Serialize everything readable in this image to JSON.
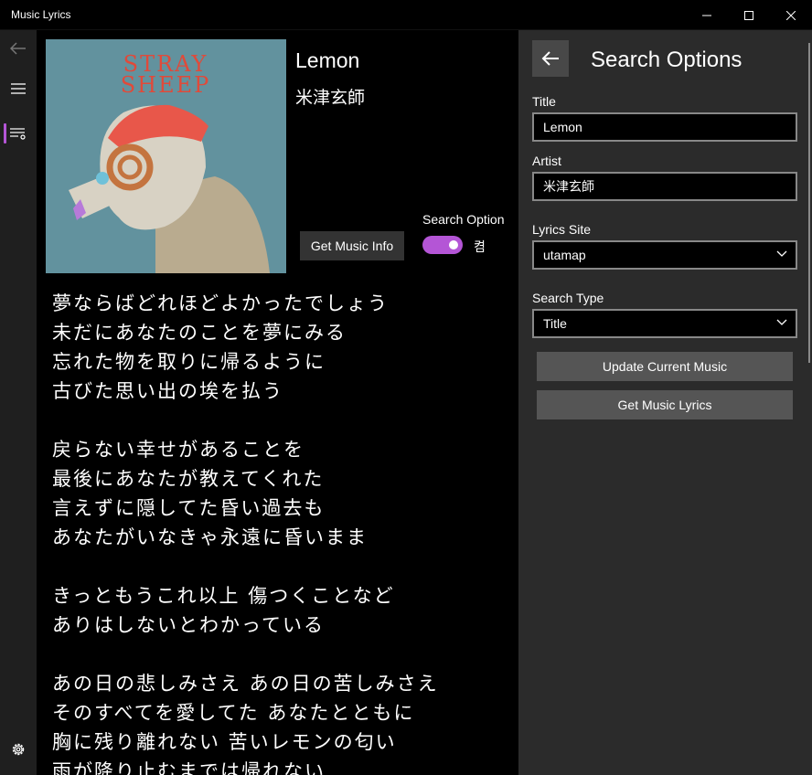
{
  "window": {
    "title": "Music Lyrics"
  },
  "nav": {
    "back_icon": "back-arrow-icon",
    "menu_icon": "hamburger-icon",
    "lyrics_icon": "lyrics-list-icon",
    "settings_icon": "gear-icon",
    "accent": "#b455d6"
  },
  "song": {
    "title": "Lemon",
    "artist": "米津玄師",
    "album_art_text": "STRAY SHEEP"
  },
  "controls": {
    "get_info_label": "Get Music Info",
    "search_option_label": "Search Option",
    "search_option_on": true,
    "search_option_state": "켬"
  },
  "lyrics": [
    "夢ならばどれほどよかったでしょう",
    "未だにあなたのことを夢にみる",
    "忘れた物を取りに帰るように",
    "古びた思い出の埃を払う",
    "",
    "戻らない幸せがあることを",
    "最後にあなたが教えてくれた",
    "言えずに隠してた昏い過去も",
    "あなたがいなきゃ永遠に昏いまま",
    "",
    "きっともうこれ以上 傷つくことなど",
    "ありはしないとわかっている",
    "",
    "あの日の悲しみさえ あの日の苦しみさえ",
    "そのすべてを愛してた あなたとともに",
    "胸に残り離れない 苦いレモンの匂い",
    "雨が降り止むまでは帰れない"
  ],
  "search_options": {
    "title": "Search Options",
    "title_label": "Title",
    "title_value": "Lemon",
    "artist_label": "Artist",
    "artist_value": "米津玄師",
    "site_label": "Lyrics Site",
    "site_value": "utamap",
    "type_label": "Search Type",
    "type_value": "Title",
    "update_label": "Update Current Music",
    "get_lyrics_label": "Get Music Lyrics"
  }
}
